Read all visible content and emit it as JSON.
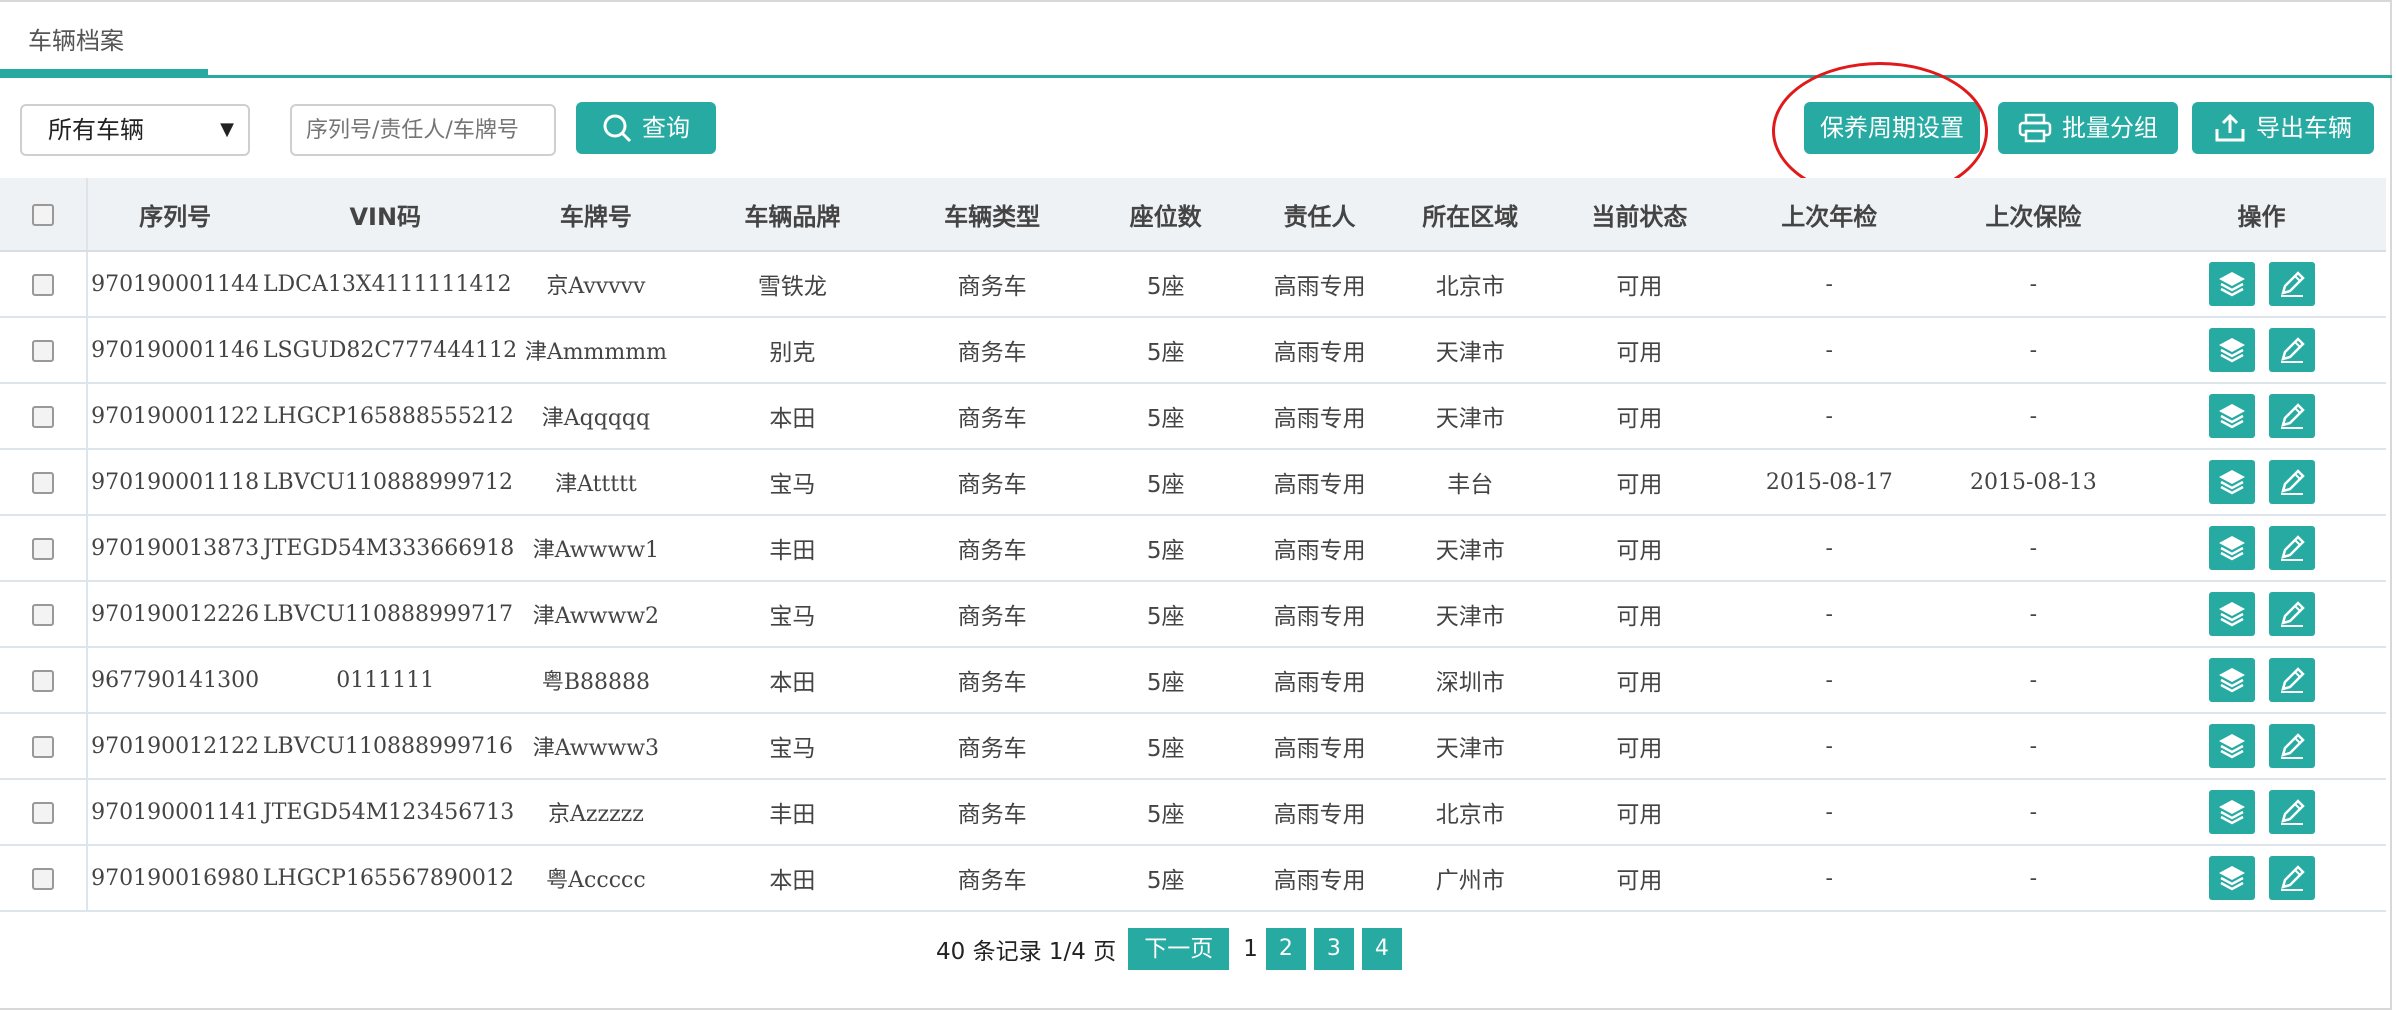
{
  "tab": {
    "label": "车辆档案"
  },
  "toolbar": {
    "filter_value": "所有车辆",
    "search_placeholder": "序列号/责任人/车牌号",
    "query_label": "查询",
    "maintenance_label": "保养周期设置",
    "batch_group_label": "批量分组",
    "export_label": "导出车辆"
  },
  "table": {
    "headers": [
      "序列号",
      "VIN码",
      "车牌号",
      "车辆品牌",
      "车辆类型",
      "座位数",
      "责任人",
      "所在区域",
      "当前状态",
      "上次年检",
      "上次保险",
      "操作"
    ],
    "rows": [
      [
        "970190001144",
        "LDCA13X4111111412",
        "京Avvvvv",
        "雪铁龙",
        "商务车",
        "5座",
        "高雨专用",
        "北京市",
        "可用",
        "-",
        "-"
      ],
      [
        "970190001146",
        "LSGUD82C777444112",
        "津Ammmmm",
        "别克",
        "商务车",
        "5座",
        "高雨专用",
        "天津市",
        "可用",
        "-",
        "-"
      ],
      [
        "970190001122",
        "LHGCP165888555212",
        "津Aqqqqq",
        "本田",
        "商务车",
        "5座",
        "高雨专用",
        "天津市",
        "可用",
        "-",
        "-"
      ],
      [
        "970190001118",
        "LBVCU110888999712",
        "津Attttt",
        "宝马",
        "商务车",
        "5座",
        "高雨专用",
        "丰台",
        "可用",
        "2015-08-17",
        "2015-08-13"
      ],
      [
        "970190013873",
        "JTEGD54M333666918",
        "津Awwww1",
        "丰田",
        "商务车",
        "5座",
        "高雨专用",
        "天津市",
        "可用",
        "-",
        "-"
      ],
      [
        "970190012226",
        "LBVCU110888999717",
        "津Awwww2",
        "宝马",
        "商务车",
        "5座",
        "高雨专用",
        "天津市",
        "可用",
        "-",
        "-"
      ],
      [
        "967790141300",
        "0111111",
        "粤B88888",
        "本田",
        "商务车",
        "5座",
        "高雨专用",
        "深圳市",
        "可用",
        "-",
        "-"
      ],
      [
        "970190012122",
        "LBVCU110888999716",
        "津Awwww3",
        "宝马",
        "商务车",
        "5座",
        "高雨专用",
        "天津市",
        "可用",
        "-",
        "-"
      ],
      [
        "970190001141",
        "JTEGD54M123456713",
        "京Azzzzz",
        "丰田",
        "商务车",
        "5座",
        "高雨专用",
        "北京市",
        "可用",
        "-",
        "-"
      ],
      [
        "970190016980",
        "LHGCP165567890012",
        "粤Accccc",
        "本田",
        "商务车",
        "5座",
        "高雨专用",
        "广州市",
        "可用",
        "-",
        "-"
      ]
    ]
  },
  "pager": {
    "info": "40 条记录 1/4 页",
    "next_label": "下一页",
    "current": "1",
    "pages": [
      "2",
      "3",
      "4"
    ]
  },
  "colors": {
    "accent": "#26aaa1",
    "highlight": "#e01a1a"
  },
  "icons": {
    "row_action_1": "layers-icon",
    "row_action_2": "pencil-edit-icon"
  }
}
